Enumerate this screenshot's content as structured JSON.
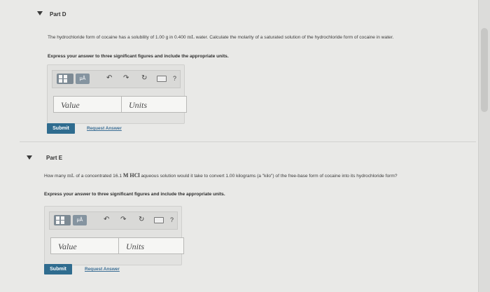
{
  "part_d": {
    "title": "Part D",
    "question_pre": "The hydrochloride form of cocaine has a solubility of 1.00 g in 0.400 ",
    "question_unit": "mL",
    "question_post": " water. Calculate the molarity of a saturated solution of the hydrochloride form of cocaine in water.",
    "instruction": "Express your answer to three significant figures and include the appropriate units.",
    "value_placeholder": "Value",
    "units_placeholder": "Units",
    "submit_label": "Submit",
    "request_answer_label": "Request Answer"
  },
  "part_e": {
    "title": "Part E",
    "question_pre": "How many ",
    "question_unit1": "mL",
    "question_mid": " of a concentrated 16.1 ",
    "question_chem": "M HCl",
    "question_post": " aqueous solution would it take to convert 1.00 kilograms (a \"kilo\") of the free-base form of cocaine into its hydrochloride form?",
    "instruction": "Express your answer to three significant figures and include the appropriate units.",
    "value_placeholder": "Value",
    "units_placeholder": "Units",
    "submit_label": "Submit",
    "request_answer_label": "Request Answer"
  },
  "toolbar": {
    "mu_label": "μÅ",
    "undo_glyph": "↶",
    "redo_glyph": "↷",
    "reset_glyph": "↻",
    "help_label": "?",
    "icons": [
      "templates-icon",
      "units-icon",
      "undo-icon",
      "redo-icon",
      "reset-icon",
      "keyboard-icon",
      "help-icon"
    ]
  },
  "colors": {
    "submit_bg": "#2f6c8f",
    "link": "#3b6e95",
    "page_bg": "#e9e9e7"
  }
}
